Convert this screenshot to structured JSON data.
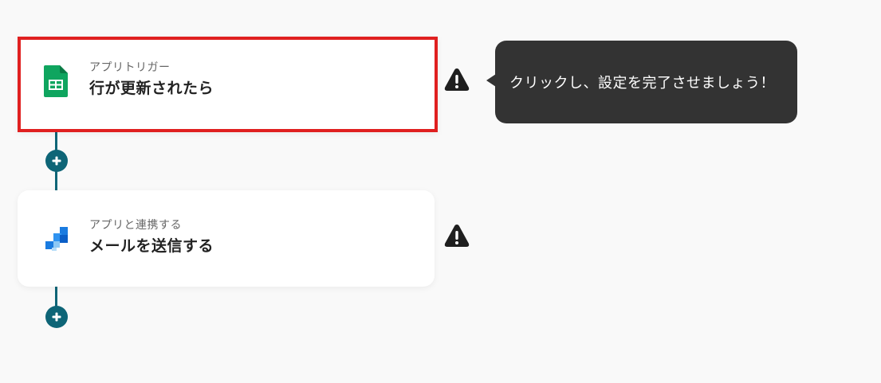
{
  "flow": {
    "steps": [
      {
        "subtitle": "アプリトリガー",
        "title": "行が更新されたら",
        "icon": "google-sheets-icon",
        "warning_icon": "warning-icon",
        "highlighted": true
      },
      {
        "subtitle": "アプリと連携する",
        "title": "メールを送信する",
        "icon": "email-app-icon",
        "warning_icon": "warning-icon",
        "highlighted": false
      }
    ],
    "add_button_icon": "plus-icon"
  },
  "tooltip": {
    "text": "クリックし、設定を完了させましょう！"
  },
  "colors": {
    "background": "#f9f9f9",
    "connector": "#0e6577",
    "highlight_border": "#e02020",
    "tooltip_bg": "#333333",
    "sheets_green": "#0fa55f"
  }
}
